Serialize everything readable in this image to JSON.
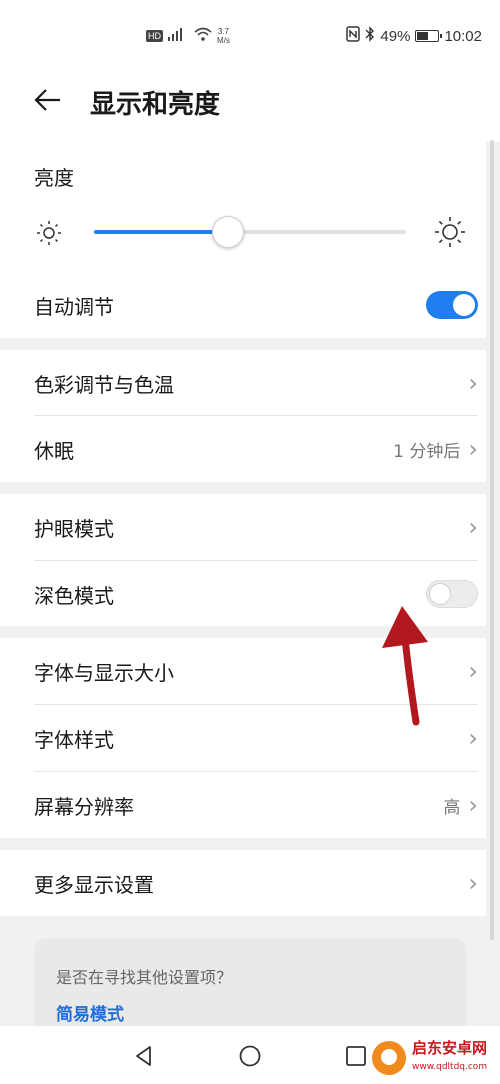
{
  "status_bar": {
    "hd": "HD",
    "signal_type": "4G",
    "net_speed": "3.7",
    "net_unit": "M/s",
    "battery": "49%",
    "time": "10:02"
  },
  "header": {
    "title": "显示和亮度"
  },
  "brightness": {
    "label": "亮度",
    "level": 0.43
  },
  "auto_adjust": {
    "label": "自动调节",
    "on": true
  },
  "settings": [
    {
      "label": "色彩调节与色温",
      "value": ""
    },
    {
      "label": "休眠",
      "value": "1 分钟后"
    },
    {
      "label": "护眼模式",
      "value": ""
    },
    {
      "label": "深色模式",
      "toggle": false
    },
    {
      "label": "字体与显示大小",
      "value": ""
    },
    {
      "label": "字体样式",
      "value": ""
    },
    {
      "label": "屏幕分辨率",
      "value": "高"
    },
    {
      "label": "更多显示设置",
      "value": ""
    }
  ],
  "suggestion": {
    "question": "是否在寻找其他设置项？",
    "link": "简易模式"
  },
  "watermark": {
    "name": "启东安卓网",
    "url": "www.qdltdq.com"
  },
  "colors": {
    "accent": "#1f7ff1",
    "arrow": "#b2191f"
  }
}
